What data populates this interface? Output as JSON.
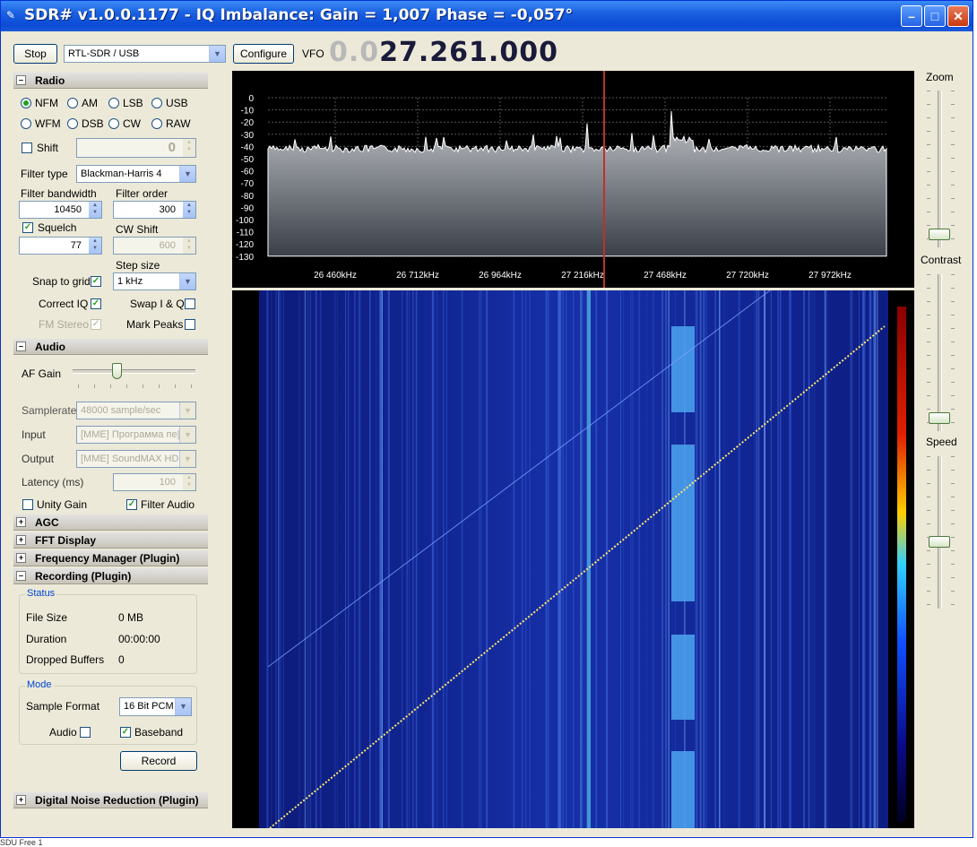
{
  "window": {
    "title": "SDR# v1.0.0.1177 - IQ Imbalance: Gain = 1,007 Phase = -0,057°"
  },
  "toolbar": {
    "stop_label": "Stop",
    "device": "RTL-SDR / USB",
    "configure_label": "Configure",
    "vfo_label": "VFO",
    "vfo_dim": "0.0",
    "vfo_value": "27.261.000"
  },
  "radio": {
    "section": "Radio",
    "modes": [
      "NFM",
      "AM",
      "LSB",
      "USB",
      "WFM",
      "DSB",
      "CW",
      "RAW"
    ],
    "selected_mode": "NFM",
    "shift_label": "Shift",
    "shift_value": "0",
    "filter_type_label": "Filter type",
    "filter_type": "Blackman-Harris 4",
    "filter_bandwidth_label": "Filter bandwidth",
    "filter_bandwidth": "10450",
    "filter_order_label": "Filter order",
    "filter_order": "300",
    "squelch_label": "Squelch",
    "squelch_value": "77",
    "cw_shift_label": "CW Shift",
    "cw_shift_value": "600",
    "step_size_label": "Step size",
    "snap_label": "Snap to grid",
    "step_size": "1 kHz",
    "correct_iq_label": "Correct IQ",
    "swap_iq_label": "Swap I & Q",
    "fm_stereo_label": "FM Stereo",
    "mark_peaks_label": "Mark Peaks"
  },
  "audio": {
    "section": "Audio",
    "af_gain_label": "AF Gain",
    "samplerate_label": "Samplerate",
    "samplerate": "48000 sample/sec",
    "input_label": "Input",
    "input": "[MME] Программа пе|",
    "output_label": "Output",
    "output": "[MME] SoundMAX HD",
    "latency_label": "Latency (ms)",
    "latency": "100",
    "unity_gain_label": "Unity Gain",
    "filter_audio_label": "Filter Audio"
  },
  "sections": {
    "agc": "AGC",
    "fft": "FFT Display",
    "freq_mgr": "Frequency Manager (Plugin)",
    "recording": "Recording (Plugin)",
    "dnr": "Digital Noise Reduction (Plugin)"
  },
  "recording": {
    "status_group": "Status",
    "file_size_label": "File Size",
    "file_size": "0 MB",
    "duration_label": "Duration",
    "duration": "00:00:00",
    "dropped_label": "Dropped Buffers",
    "dropped": "0",
    "mode_group": "Mode",
    "sample_format_label": "Sample Format",
    "sample_format": "16 Bit PCM",
    "audio_label": "Audio",
    "baseband_label": "Baseband",
    "record_label": "Record"
  },
  "spectrum": {
    "db_ticks": [
      "0",
      "-10",
      "-20",
      "-30",
      "-40",
      "-50",
      "-60",
      "-70",
      "-80",
      "-90",
      "-100",
      "-110",
      "-120",
      "-130"
    ],
    "freq_ticks": [
      "26 460kHz",
      "26 712kHz",
      "26 964kHz",
      "27 216kHz",
      "27 468kHz",
      "27 720kHz",
      "27 972kHz"
    ]
  },
  "right_panel": {
    "zoom_label": "Zoom",
    "contrast_label": "Contrast",
    "speed_label": "Speed"
  },
  "taskbar_fragment": "SDU Free 1"
}
